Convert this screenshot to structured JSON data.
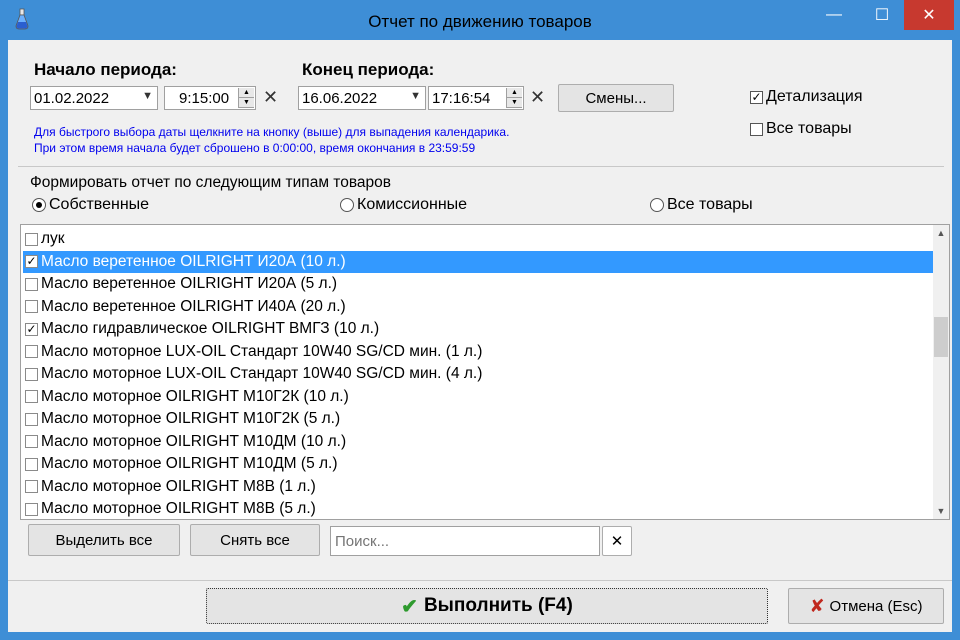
{
  "window": {
    "title": "Отчет по движению товаров",
    "controls": {
      "minimize": "—",
      "maximize": "☐",
      "close": "✕"
    }
  },
  "period": {
    "start_label": "Начало периода:",
    "start_date": "01.02.2022",
    "start_time": "9:15:00",
    "end_label": "Конец периода:",
    "end_date": "16.06.2022",
    "end_time": "17:16:54",
    "clear_glyph": "✕",
    "shifts_button": "Смены..."
  },
  "options": {
    "detail_label": "Детализация",
    "detail_checked": true,
    "all_goods_label": "Все товары",
    "all_goods_checked": false
  },
  "hint": {
    "line1": "Для быстрого выбора даты щелкните на кнопку (выше) для выпадения календарика.",
    "line2": "При этом время начала будет сброшено в 0:00:00, время окончания в 23:59:59"
  },
  "types": {
    "group_label": "Формировать отчет по следующим типам товаров",
    "options": [
      {
        "label": "Собственные",
        "selected": true
      },
      {
        "label": "Комиссионные",
        "selected": false
      },
      {
        "label": "Все товары",
        "selected": false
      }
    ]
  },
  "goods_list": [
    {
      "label": "лук",
      "checked": false,
      "selected": false
    },
    {
      "label": "Масло веретенное OILRIGHT И20А (10 л.)",
      "checked": true,
      "selected": true
    },
    {
      "label": "Масло веретенное OILRIGHT И20А (5 л.)",
      "checked": false,
      "selected": false
    },
    {
      "label": "Масло веретенное OILRIGHT И40А (20 л.)",
      "checked": false,
      "selected": false
    },
    {
      "label": "Масло гидравлическое OILRIGHT ВМГЗ (10 л.)",
      "checked": true,
      "selected": false
    },
    {
      "label": "Масло моторное LUX-OIL Стандарт 10W40 SG/CD мин. (1 л.)",
      "checked": false,
      "selected": false
    },
    {
      "label": "Масло моторное LUX-OIL Стандарт 10W40 SG/CD мин. (4 л.)",
      "checked": false,
      "selected": false
    },
    {
      "label": "Масло моторное OILRIGHT М10Г2К (10 л.)",
      "checked": false,
      "selected": false
    },
    {
      "label": "Масло моторное OILRIGHT М10Г2К (5 л.)",
      "checked": false,
      "selected": false
    },
    {
      "label": "Масло моторное OILRIGHT М10ДМ (10 л.)",
      "checked": false,
      "selected": false
    },
    {
      "label": "Масло моторное OILRIGHT М10ДМ (5 л.)",
      "checked": false,
      "selected": false
    },
    {
      "label": "Масло моторное OILRIGHT М8В (1 л.)",
      "checked": false,
      "selected": false
    },
    {
      "label": "Масло моторное OILRIGHT М8В (5 л.)",
      "checked": false,
      "selected": false
    }
  ],
  "list_actions": {
    "select_all": "Выделить все",
    "deselect_all": "Снять все",
    "search_placeholder": "Поиск...",
    "search_value": "",
    "clear_glyph": "✕"
  },
  "footer": {
    "run_label": "Выполнить (F4)",
    "run_icon": "✔",
    "cancel_label": "Отмена (Esc)",
    "cancel_icon": "✘"
  },
  "colors": {
    "titlebar": "#3e8ed6",
    "close_button": "#c7392f",
    "selection": "#3399ff",
    "hint_text": "#0000ee",
    "run_icon": "#2e9a2e",
    "cancel_icon": "#c0281e"
  }
}
